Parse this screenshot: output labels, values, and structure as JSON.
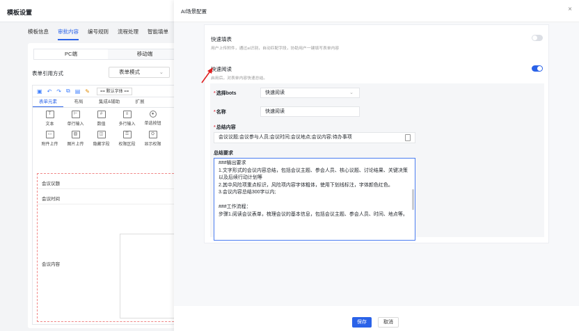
{
  "background": {
    "title": "模板设置",
    "tabs": [
      {
        "label": "模板信息",
        "active": false
      },
      {
        "label": "审批内容",
        "active": true
      },
      {
        "label": "编号规则",
        "active": false
      },
      {
        "label": "流程处理",
        "active": false
      },
      {
        "label": "智能填单",
        "active": false
      }
    ],
    "device_tabs": [
      "PC端",
      "移动端"
    ],
    "ref_label": "表单引用方式",
    "ref_value": "表单模式",
    "font_select": "== 默认字体 ==",
    "component_tabs": [
      "表单元素",
      "布局",
      "集成&辅助",
      "扩展"
    ],
    "widgets": [
      {
        "label": "文本",
        "icon": "text-icon"
      },
      {
        "label": "单行输入",
        "icon": "single-line-icon"
      },
      {
        "label": "数值",
        "icon": "number-icon"
      },
      {
        "label": "多行输入",
        "icon": "multi-line-icon"
      },
      {
        "label": "单选按钮",
        "icon": "radio-icon"
      },
      {
        "label": "附件上传",
        "icon": "attachment-icon"
      },
      {
        "label": "图片上传",
        "icon": "image-icon"
      },
      {
        "label": "隐藏字段",
        "icon": "hidden-field-icon"
      },
      {
        "label": "权限区段",
        "icon": "permission-icon"
      },
      {
        "label": "显示权限",
        "icon": "display-permission-icon"
      }
    ],
    "form_fields": [
      "会议议题",
      "会议时间",
      "会议内容"
    ]
  },
  "modal": {
    "title": "AI场景配置",
    "close_symbol": "×",
    "quick_fill": {
      "title": "快速填表",
      "desc": "用户上传附件，通过ai识别，自动匹配字段，协助用户一键填写表单内容",
      "enabled": false
    },
    "quick_read": {
      "title": "快速阅读",
      "desc": "启用后，对表单内容快速总结。",
      "enabled": true
    },
    "bots_label": "选择bots",
    "bots_value": "快速阅读",
    "name_label": "名称",
    "name_value": "快速阅读",
    "summary_label": "总结内容",
    "summary_value": "会议议题;会议参与人员;会议时间;会议地点;会议内容;待办事项",
    "requirements_label": "总结要求",
    "requirements_text": "###输出要求\n1.文字形式的会议内容总结，包括会议主题、参会人员、核心议题、讨论结果、关键决策以及后续行动计划等\n2.其中风险项重点标识，风险项内容字体粗体，使用下划线标注，字体颜色红色。\n3.会议内容总结300字以内;\n\n###工作流程：\n步骤1.阅读会议表单，梳理会议的基本信息，包括会议主题、参会人员、时间、地点等。",
    "save_label": "保存",
    "cancel_label": "取消"
  },
  "colors": {
    "accent": "#2a62e8",
    "required": "#e34d59",
    "annotation_arrow": "#e02020"
  }
}
